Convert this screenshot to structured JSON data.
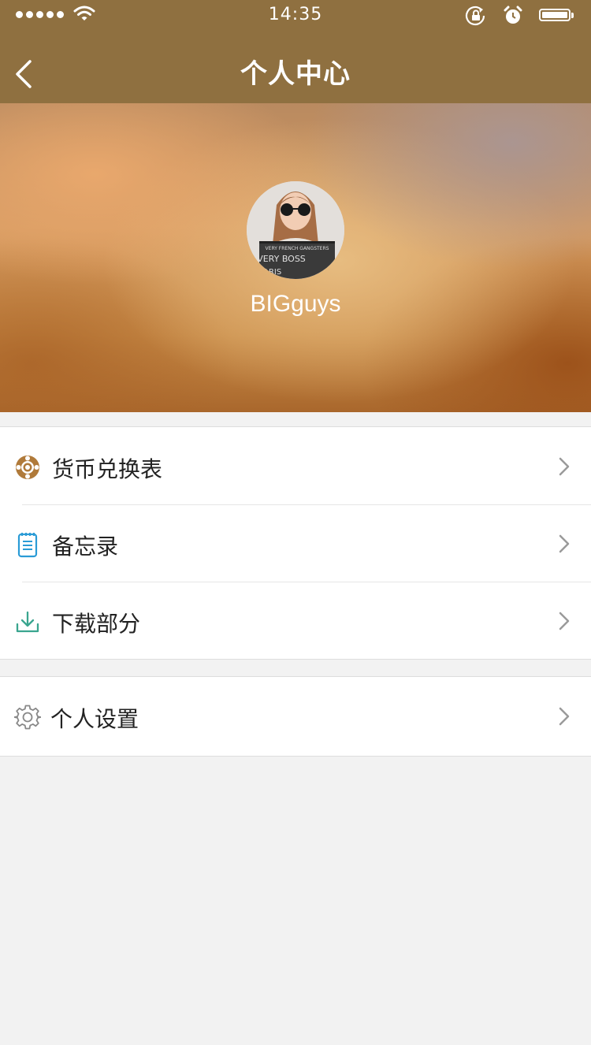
{
  "status_bar": {
    "time": "14:35"
  },
  "nav": {
    "title": "个人中心"
  },
  "profile": {
    "username": "BIGguys",
    "avatar_sign_line1": "VERY FRENCH GANGSTERS",
    "avatar_sign_line2": "VERY BOSS",
    "avatar_sign_line3": "PARIS"
  },
  "menu_group_1": [
    {
      "label": "货币兑换表",
      "icon": "lifebuoy-icon"
    },
    {
      "label": "备忘录",
      "icon": "notepad-icon"
    },
    {
      "label": "下载部分",
      "icon": "download-icon"
    }
  ],
  "menu_group_2": [
    {
      "label": "个人设置",
      "icon": "gear-icon"
    }
  ],
  "colors": {
    "nav_bar": "#8f7040",
    "background": "#f2f2f2",
    "lifebuoy_icon": "#b07a3a",
    "notepad_icon": "#2a9bd6",
    "download_icon": "#3aa58f",
    "gear_icon": "#888888",
    "chevron": "#9a9a9a"
  }
}
